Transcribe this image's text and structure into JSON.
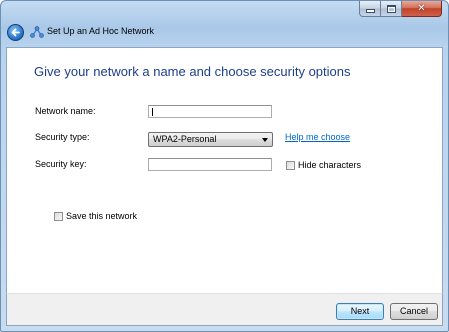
{
  "window": {
    "controls": {
      "minimize_icon": "minimize-icon",
      "maximize_icon": "maximize-icon",
      "close_glyph": "✕"
    }
  },
  "titlebar": {
    "back_icon": "back-arrow-icon",
    "network_icon": "ad-hoc-network-icon",
    "title": "Set Up an Ad Hoc Network"
  },
  "main": {
    "heading": "Give your network a name and choose security options",
    "network_name": {
      "label": "Network name:",
      "value": ""
    },
    "security_type": {
      "label": "Security type:",
      "selected": "WPA2-Personal",
      "help_link": "Help me choose"
    },
    "security_key": {
      "label": "Security key:",
      "value": "",
      "hide_characters_label": "Hide characters",
      "hide_characters_checked": false
    },
    "save_network": {
      "label": "Save this network",
      "checked": false
    }
  },
  "footer": {
    "next_label": "Next",
    "cancel_label": "Cancel"
  },
  "colors": {
    "heading": "#1e3f8c",
    "link": "#0066cc",
    "frame": "#b8d3ee",
    "close_button": "#c1432b"
  }
}
